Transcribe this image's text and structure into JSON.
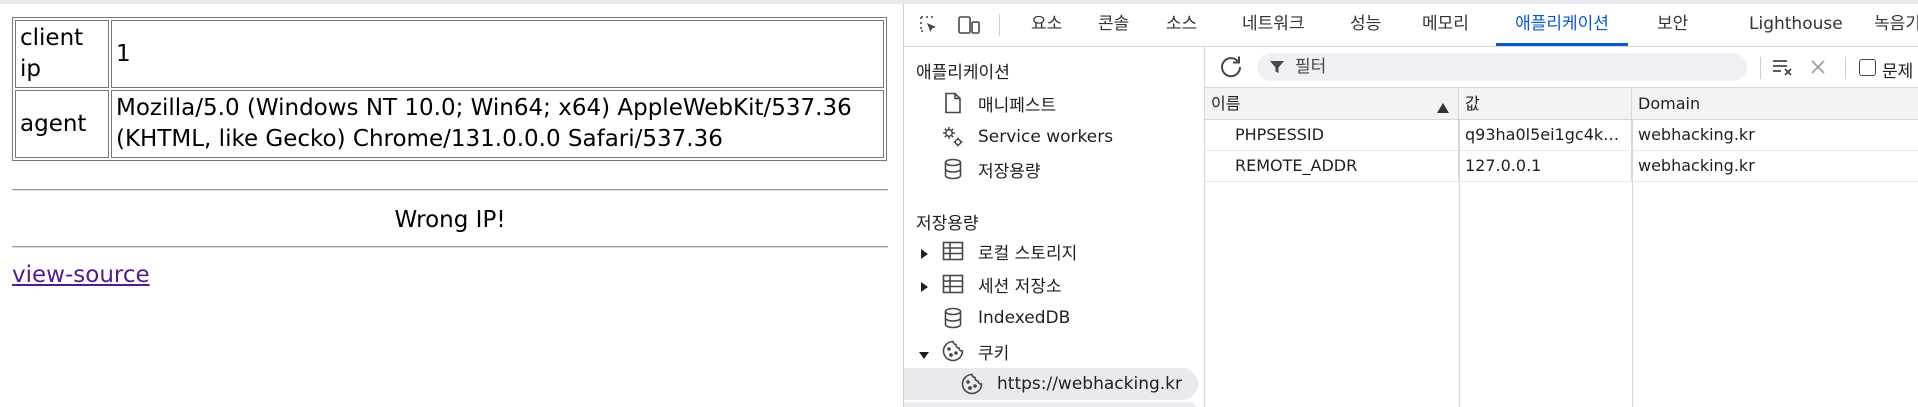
{
  "page": {
    "rows": [
      {
        "key": "client ip",
        "value": "1"
      },
      {
        "key": "agent",
        "value": "Mozilla/5.0 (Windows NT 10.0; Win64; x64) AppleWebKit/537.36 (KHTML, like Gecko) Chrome/131.0.0.0 Safari/537.36"
      }
    ],
    "message": "Wrong IP!",
    "link": "view-source"
  },
  "devtools": {
    "tabs": [
      "요소",
      "콘솔",
      "소스",
      "네트워크",
      "성능",
      "메모리",
      "애플리케이션",
      "보안",
      "Lighthouse",
      "녹음기"
    ],
    "active_tab": "애플리케이션",
    "sidebar": {
      "app_header": "애플리케이션",
      "app_items": [
        {
          "label": "매니페스트",
          "icon": "file-icon"
        },
        {
          "label": "Service workers",
          "icon": "gears-icon"
        },
        {
          "label": "저장용량",
          "icon": "database-icon"
        }
      ],
      "storage_header": "저장용량",
      "storage_items": [
        {
          "label": "로컬 스토리지",
          "icon": "table-icon"
        },
        {
          "label": "세션 저장소",
          "icon": "table-icon"
        },
        {
          "label": "IndexedDB",
          "icon": "database-icon"
        },
        {
          "label": "쿠키",
          "icon": "cookie-icon"
        }
      ],
      "cookie_origin": "https://webhacking.kr"
    },
    "filter_placeholder": "필터",
    "issues_label": "문제",
    "columns": [
      "이름",
      "값",
      "Domain"
    ],
    "cookies": [
      {
        "name": "PHPSESSID",
        "value": "q93ha0l5ei1gc4k…",
        "domain": "webhacking.kr"
      },
      {
        "name": "REMOTE_ADDR",
        "value": "127.0.0.1",
        "domain": "webhacking.kr"
      }
    ]
  }
}
